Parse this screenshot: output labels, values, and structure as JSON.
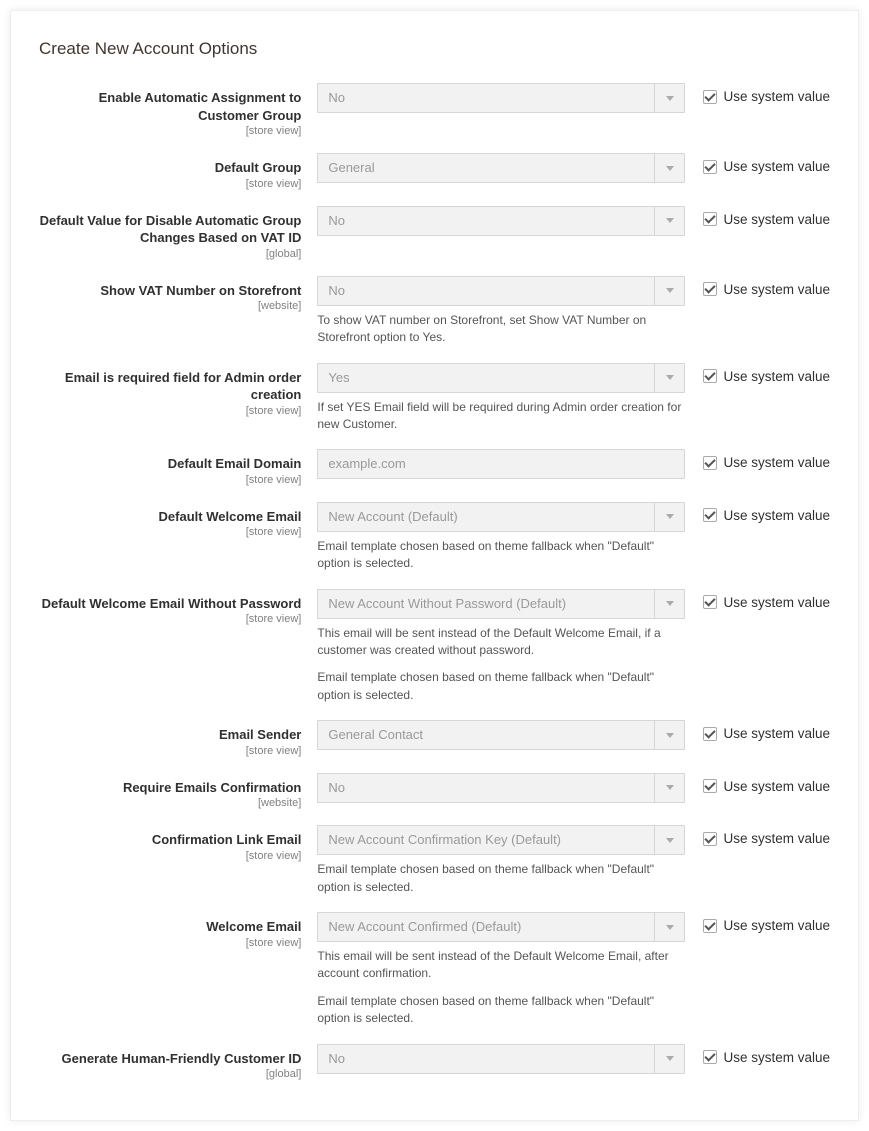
{
  "section_title": "Create New Account Options",
  "use_system_value_label": "Use system value",
  "scopes": {
    "store_view": "[store view]",
    "global": "[global]",
    "website": "[website]"
  },
  "fields": [
    {
      "id": "auto_assign_group",
      "label": "Enable Automatic Assignment to Customer Group",
      "scope": "store_view",
      "type": "select",
      "value": "No",
      "notes": []
    },
    {
      "id": "default_group",
      "label": "Default Group",
      "scope": "store_view",
      "type": "select",
      "value": "General",
      "notes": []
    },
    {
      "id": "disable_auto_group_vat",
      "label": "Default Value for Disable Automatic Group Changes Based on VAT ID",
      "scope": "global",
      "type": "select",
      "value": "No",
      "notes": []
    },
    {
      "id": "show_vat_storefront",
      "label": "Show VAT Number on Storefront",
      "scope": "website",
      "type": "select",
      "value": "No",
      "notes": [
        "To show VAT number on Storefront, set Show VAT Number on Storefront option to Yes."
      ]
    },
    {
      "id": "email_required_admin_order",
      "label": "Email is required field for Admin order creation",
      "scope": "store_view",
      "type": "select",
      "value": "Yes",
      "notes": [
        "If set YES Email field will be required during Admin order creation for new Customer."
      ]
    },
    {
      "id": "default_email_domain",
      "label": "Default Email Domain",
      "scope": "store_view",
      "type": "text",
      "value": "example.com",
      "notes": []
    },
    {
      "id": "default_welcome_email",
      "label": "Default Welcome Email",
      "scope": "store_view",
      "type": "select",
      "value": "New Account (Default)",
      "notes": [
        "Email template chosen based on theme fallback when \"Default\" option is selected."
      ]
    },
    {
      "id": "default_welcome_email_no_pw",
      "label": "Default Welcome Email Without Password",
      "scope": "store_view",
      "type": "select",
      "value": "New Account Without Password (Default)",
      "notes": [
        "This email will be sent instead of the Default Welcome Email, if a customer was created without password.",
        "Email template chosen based on theme fallback when \"Default\" option is selected."
      ]
    },
    {
      "id": "email_sender",
      "label": "Email Sender",
      "scope": "store_view",
      "type": "select",
      "value": "General Contact",
      "notes": []
    },
    {
      "id": "require_confirmation",
      "label": "Require Emails Confirmation",
      "scope": "website",
      "type": "select",
      "value": "No",
      "notes": []
    },
    {
      "id": "confirmation_link_email",
      "label": "Confirmation Link Email",
      "scope": "store_view",
      "type": "select",
      "value": "New Account Confirmation Key (Default)",
      "notes": [
        "Email template chosen based on theme fallback when \"Default\" option is selected."
      ]
    },
    {
      "id": "welcome_email",
      "label": "Welcome Email",
      "scope": "store_view",
      "type": "select",
      "value": "New Account Confirmed (Default)",
      "notes": [
        "This email will be sent instead of the Default Welcome Email, after account confirmation.",
        "Email template chosen based on theme fallback when \"Default\" option is selected."
      ]
    },
    {
      "id": "generate_human_friendly_id",
      "label": "Generate Human-Friendly Customer ID",
      "scope": "global",
      "type": "select",
      "value": "No",
      "notes": []
    }
  ]
}
